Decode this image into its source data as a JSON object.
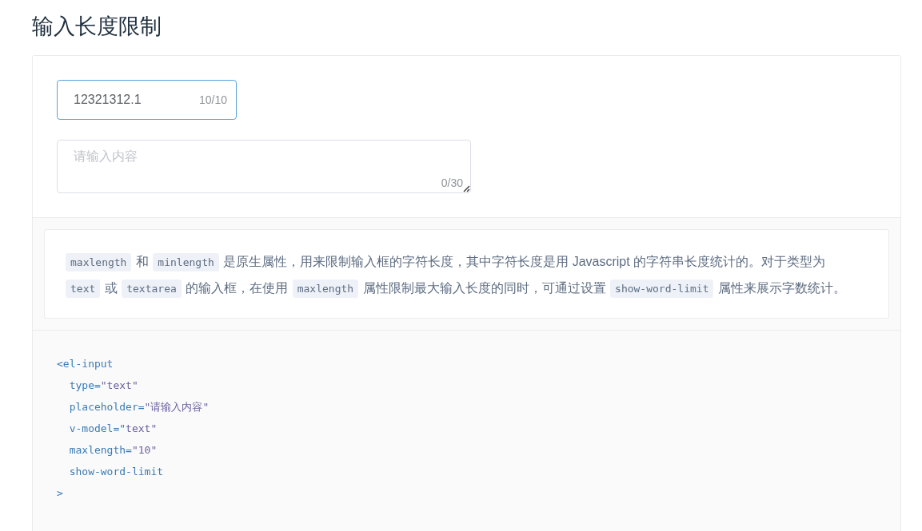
{
  "title": "输入长度限制",
  "demo": {
    "input": {
      "value": "12321312.1",
      "counter": "10/10",
      "focused": true
    },
    "textarea": {
      "placeholder": "请输入内容",
      "counter": "0/30",
      "focused": false
    }
  },
  "description": [
    {
      "kind": "code",
      "text": "maxlength"
    },
    {
      "kind": "text",
      "text": " 和 "
    },
    {
      "kind": "code",
      "text": "minlength"
    },
    {
      "kind": "text",
      "text": " 是原生属性，用来限制输入框的字符长度，其中字符长度是用 Javascript 的字符串长度统计的。对于类型为 "
    },
    {
      "kind": "code",
      "text": "text"
    },
    {
      "kind": "text",
      "text": " 或 "
    },
    {
      "kind": "code",
      "text": "textarea"
    },
    {
      "kind": "text",
      "text": " 的输入框，在使用 "
    },
    {
      "kind": "code",
      "text": "maxlength"
    },
    {
      "kind": "text",
      "text": " 属性限制最大输入长度的同时，可通过设置 "
    },
    {
      "kind": "code",
      "text": "show-word-limit"
    },
    {
      "kind": "text",
      "text": " 属性来展示字数统计。"
    }
  ],
  "code": [
    "<el-input",
    "  type=\"text\"",
    "  placeholder=\"请输入内容\"",
    "  v-model=\"text\"",
    "  maxlength=\"10\"",
    "  show-word-limit",
    ">"
  ]
}
